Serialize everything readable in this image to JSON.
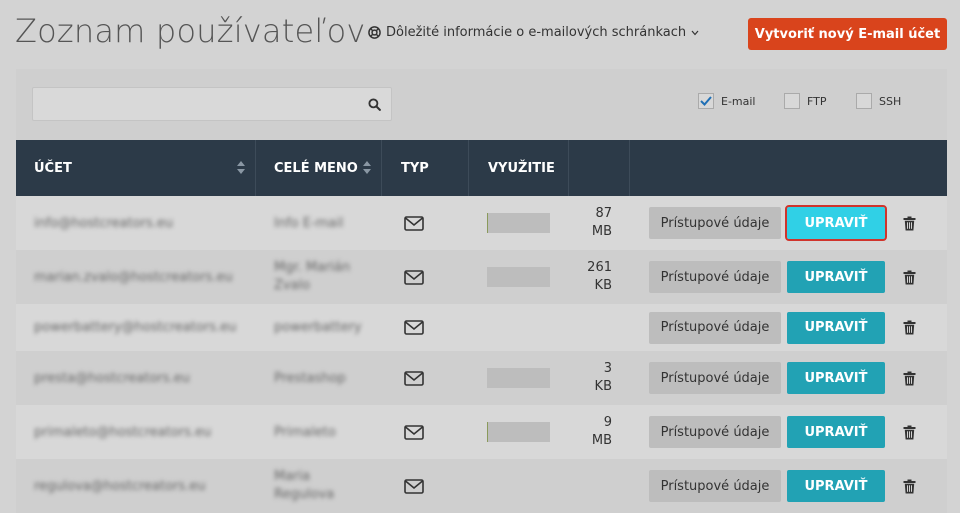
{
  "header": {
    "title": "Zoznam používateľov",
    "info_link": "Dôležité informácie o e-mailových schránkach",
    "create_button": "Vytvoriť nový E-mail účet"
  },
  "search": {
    "placeholder": "",
    "value": ""
  },
  "filters": [
    {
      "label": "E-mail",
      "checked": true
    },
    {
      "label": "FTP",
      "checked": false
    },
    {
      "label": "SSH",
      "checked": false
    }
  ],
  "table": {
    "columns": [
      "ÚČET",
      "CELÉ MENO",
      "TYP",
      "VYUŽITIE"
    ],
    "access_label": "Prístupové údaje",
    "edit_label": "UPRAVIŤ",
    "rows": [
      {
        "account": "info@hostcreators.eu",
        "name_line1": "Info E-mail",
        "name_line2": "",
        "type_icon": "envelope-icon",
        "usage_pct": 2,
        "size_value": "87",
        "size_unit": "MB",
        "has_usage": true
      },
      {
        "account": "marian.zvalo@hostcreators.eu",
        "name_line1": "Mgr. Marián",
        "name_line2": "Zvalo",
        "type_icon": "envelope-icon",
        "usage_pct": 0,
        "size_value": "261",
        "size_unit": "KB",
        "has_usage": true
      },
      {
        "account": "powerbattery@hostcreators.eu",
        "name_line1": "powerbattery",
        "name_line2": "",
        "type_icon": "envelope-icon",
        "usage_pct": 0,
        "size_value": "",
        "size_unit": "",
        "has_usage": false
      },
      {
        "account": "presta@hostcreators.eu",
        "name_line1": "Prestashop",
        "name_line2": "",
        "type_icon": "envelope-icon",
        "usage_pct": 0,
        "size_value": "3",
        "size_unit": "KB",
        "has_usage": true
      },
      {
        "account": "primaleto@hostcreators.eu",
        "name_line1": "Primaleto",
        "name_line2": "",
        "type_icon": "envelope-icon",
        "usage_pct": 2,
        "size_value": "9",
        "size_unit": "MB",
        "has_usage": true
      },
      {
        "account": "regulova@hostcreators.eu",
        "name_line1": "Maria",
        "name_line2": "Regulova",
        "type_icon": "envelope-icon",
        "usage_pct": 0,
        "size_value": "",
        "size_unit": "",
        "has_usage": false
      }
    ]
  },
  "colors": {
    "accent_orange": "#d9441c",
    "edit_teal": "#22a2b4",
    "header_dark": "#2c3a48"
  }
}
